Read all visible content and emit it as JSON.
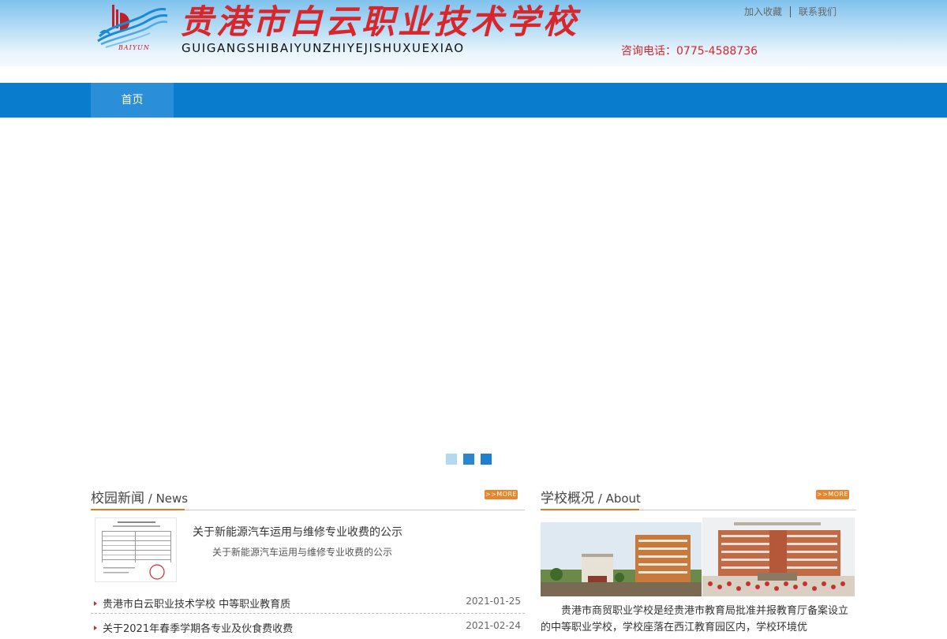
{
  "header": {
    "logo_text": "BAIYUN",
    "school_name": "贵港市白云职业技术学校",
    "school_pinyin": "GUIGANGSHIBAIYUNZHIYEJISHUXUEXIAO",
    "links": {
      "favorite": "加入收藏",
      "contact": "联系我们"
    },
    "hotline_label": "咨询电话：",
    "hotline_number": "0775-4588736"
  },
  "nav": {
    "items": [
      {
        "label": "首页"
      }
    ]
  },
  "banner": {
    "slide_count": 3,
    "active_slide": 1
  },
  "news": {
    "title_cn": "校园新闻",
    "title_en": " / News",
    "more_label": ">>MORE",
    "featured": {
      "title": "关于新能源汽车运用与维修专业收费的公示",
      "desc": "关于新能源汽车运用与维修专业收费的公示"
    },
    "items": [
      {
        "title": "贵港市白云职业技术学校 中等职业教育质",
        "date": "2021-01-25"
      },
      {
        "title": "关于2021年春季学期各专业及伙食费收费",
        "date": "2021-02-24"
      }
    ]
  },
  "about": {
    "title_cn": "学校概况",
    "title_en": " / About",
    "more_label": ">>MORE",
    "text": "贵港市商贸职业学校是经贵港市教育局批准并报教育厅备案设立的中等职业学校，学校座落在西江教育园区内，学校环境优"
  },
  "colors": {
    "brand_red": "#d8262b",
    "nav_blue": "#0a7cce",
    "accent_orange": "#e07a20"
  }
}
